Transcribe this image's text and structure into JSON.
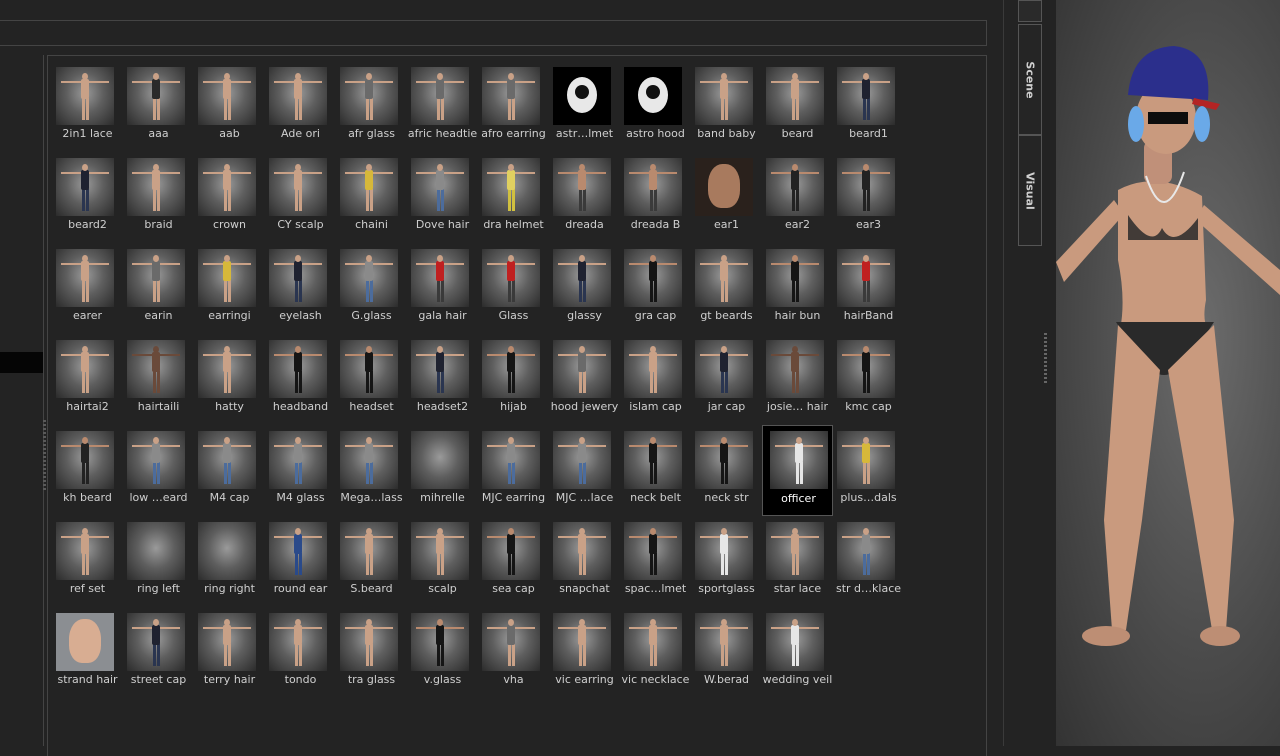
{
  "side_tabs": {
    "scene": "Scene",
    "visual": "Visual"
  },
  "selected_item": "officer",
  "assets": [
    {
      "label": "2in1 lace",
      "thumb": "figure-nude"
    },
    {
      "label": "aaa",
      "thumb": "figure-bikini"
    },
    {
      "label": "aab",
      "thumb": "figure-nude"
    },
    {
      "label": "Ade ori",
      "thumb": "figure-nude"
    },
    {
      "label": "afr glass",
      "thumb": "figure-dress"
    },
    {
      "label": "afric headtie",
      "thumb": "figure-dress"
    },
    {
      "label": "afro earring",
      "thumb": "figure-dress"
    },
    {
      "label": "astr…lmet",
      "thumb": "astronaut-helmet"
    },
    {
      "label": "astro hood",
      "thumb": "astronaut-helmet"
    },
    {
      "label": "band baby",
      "thumb": "figure-small"
    },
    {
      "label": "beard",
      "thumb": "figure-nude"
    },
    {
      "label": "beard1",
      "thumb": "figure-suit"
    },
    {
      "label": "beard2",
      "thumb": "figure-suit"
    },
    {
      "label": "braid",
      "thumb": "figure-nude"
    },
    {
      "label": "crown",
      "thumb": "figure-nude"
    },
    {
      "label": "CY scalp",
      "thumb": "figure-nude"
    },
    {
      "label": "chaini",
      "thumb": "figure-yellow"
    },
    {
      "label": "Dove hair",
      "thumb": "figure-jeans"
    },
    {
      "label": "dra helmet",
      "thumb": "figure-costume"
    },
    {
      "label": "dreada",
      "thumb": "figure-shorts"
    },
    {
      "label": "dreada B",
      "thumb": "figure-shorts"
    },
    {
      "label": "ear1",
      "thumb": "face-closeup"
    },
    {
      "label": "ear2",
      "thumb": "figure-striped"
    },
    {
      "label": "ear3",
      "thumb": "figure-striped"
    },
    {
      "label": "earer",
      "thumb": "figure-nude"
    },
    {
      "label": "earin",
      "thumb": "figure-dress"
    },
    {
      "label": "earringi",
      "thumb": "figure-yellow"
    },
    {
      "label": "eyelash",
      "thumb": "figure-suit"
    },
    {
      "label": "G.glass",
      "thumb": "figure-jeans"
    },
    {
      "label": "gala hair",
      "thumb": "figure-red"
    },
    {
      "label": "Glass",
      "thumb": "figure-red"
    },
    {
      "label": "glassy",
      "thumb": "figure-suit"
    },
    {
      "label": "gra cap",
      "thumb": "figure-black"
    },
    {
      "label": "gt beards",
      "thumb": "figure-nude"
    },
    {
      "label": "hair bun",
      "thumb": "figure-black"
    },
    {
      "label": "hairBand",
      "thumb": "figure-red"
    },
    {
      "label": "hairtai2",
      "thumb": "figure-nude"
    },
    {
      "label": "hairtaili",
      "thumb": "figure-dark"
    },
    {
      "label": "hatty",
      "thumb": "figure-nude"
    },
    {
      "label": "headband",
      "thumb": "figure-black"
    },
    {
      "label": "headset",
      "thumb": "figure-black"
    },
    {
      "label": "headset2",
      "thumb": "figure-suit"
    },
    {
      "label": "hijab",
      "thumb": "figure-black"
    },
    {
      "label": "hood jewery",
      "thumb": "figure-dress"
    },
    {
      "label": "islam cap",
      "thumb": "figure-nude"
    },
    {
      "label": "jar cap",
      "thumb": "figure-suit"
    },
    {
      "label": "josie… hair",
      "thumb": "figure-dark"
    },
    {
      "label": "kmc cap",
      "thumb": "figure-black"
    },
    {
      "label": "kh beard",
      "thumb": "figure-striped"
    },
    {
      "label": "low …eard",
      "thumb": "figure-jeans"
    },
    {
      "label": "M4 cap",
      "thumb": "figure-jeans"
    },
    {
      "label": "M4 glass",
      "thumb": "figure-jeans"
    },
    {
      "label": "Mega…lass",
      "thumb": "figure-jeans"
    },
    {
      "label": "mihrelle",
      "thumb": "empty"
    },
    {
      "label": "MJC earring",
      "thumb": "figure-jeans"
    },
    {
      "label": "MJC …lace",
      "thumb": "figure-jeans"
    },
    {
      "label": "neck belt",
      "thumb": "figure-black"
    },
    {
      "label": "neck str",
      "thumb": "figure-black"
    },
    {
      "label": "officer",
      "thumb": "figure-white"
    },
    {
      "label": "plus…dals",
      "thumb": "figure-yellow"
    },
    {
      "label": "ref set",
      "thumb": "figure-nude"
    },
    {
      "label": "ring left",
      "thumb": "empty"
    },
    {
      "label": "ring right",
      "thumb": "empty"
    },
    {
      "label": "round ear",
      "thumb": "figure-blue-dress"
    },
    {
      "label": "S.beard",
      "thumb": "figure-nude"
    },
    {
      "label": "scalp",
      "thumb": "figure-nude"
    },
    {
      "label": "sea cap",
      "thumb": "figure-black"
    },
    {
      "label": "snapchat",
      "thumb": "figure-nude"
    },
    {
      "label": "spac…lmet",
      "thumb": "figure-black"
    },
    {
      "label": "sportglass",
      "thumb": "figure-white"
    },
    {
      "label": "star lace",
      "thumb": "figure-nude"
    },
    {
      "label": "str d…klace",
      "thumb": "figure-jeans"
    },
    {
      "label": "strand hair",
      "thumb": "face-closeup-light"
    },
    {
      "label": "street cap",
      "thumb": "figure-suit"
    },
    {
      "label": "terry hair",
      "thumb": "figure-nude"
    },
    {
      "label": "tondo",
      "thumb": "figure-nude"
    },
    {
      "label": "tra glass",
      "thumb": "figure-nude"
    },
    {
      "label": "v.glass",
      "thumb": "figure-black"
    },
    {
      "label": "vha",
      "thumb": "figure-dress"
    },
    {
      "label": "vic earring",
      "thumb": "figure-nude"
    },
    {
      "label": "vic necklace",
      "thumb": "figure-nude"
    },
    {
      "label": "W.berad",
      "thumb": "figure-nude"
    },
    {
      "label": "wedding veil",
      "thumb": "figure-white"
    }
  ]
}
